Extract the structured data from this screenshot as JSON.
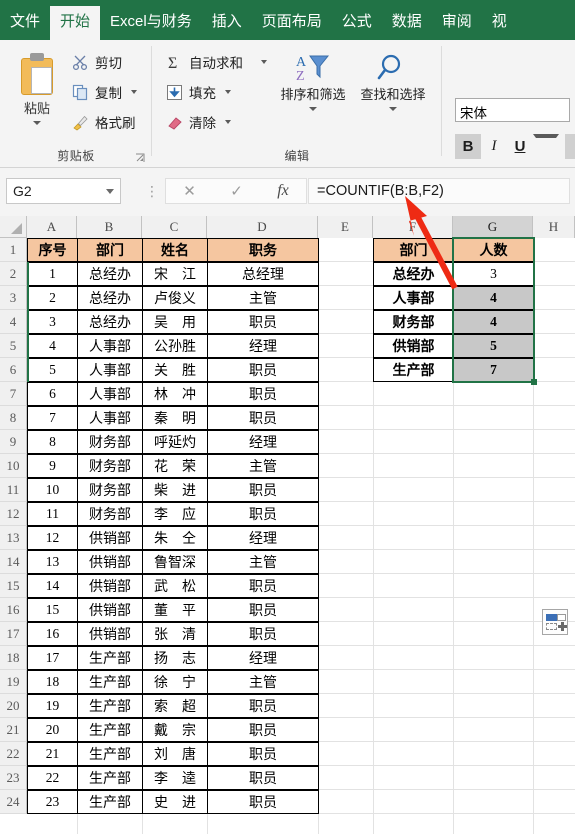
{
  "ribbon": {
    "tabs": [
      {
        "label": "文件",
        "active": false
      },
      {
        "label": "开始",
        "active": true
      },
      {
        "label": "Excel与财务",
        "active": false
      },
      {
        "label": "插入",
        "active": false
      },
      {
        "label": "页面布局",
        "active": false
      },
      {
        "label": "公式",
        "active": false
      },
      {
        "label": "数据",
        "active": false
      },
      {
        "label": "审阅",
        "active": false
      },
      {
        "label": "视",
        "active": false
      }
    ],
    "groups": [
      {
        "name": "clipboard",
        "label": "剪贴板"
      },
      {
        "name": "editing",
        "label": "编辑"
      }
    ],
    "clipboard": {
      "paste_label": "粘贴",
      "paste_icon": "clipboard-icon",
      "cut_label": "剪切",
      "cut_icon": "scissors-icon",
      "copy_label": "复制",
      "copy_icon": "copy-icon",
      "format_painter_label": "格式刷",
      "format_painter_icon": "paintbrush-icon",
      "dialog_launcher_icon": "dialog-launcher-icon"
    },
    "editing": {
      "autosum_label": "自动求和",
      "autosum_icon": "sigma-icon",
      "fill_label": "填充",
      "fill_icon": "fill-down-icon",
      "clear_label": "清除",
      "clear_icon": "eraser-icon",
      "sort_filter_label": "排序和筛选",
      "sort_filter_icon": "sort-filter-icon",
      "find_select_label": "查找和选择",
      "find_select_icon": "magnifier-icon"
    },
    "font": {
      "name_value": "宋体",
      "bold_label": "B",
      "bold_active": true,
      "italic_label": "I",
      "underline_label": "U",
      "borders_icon": "borders-icon"
    }
  },
  "formula_bar": {
    "name_box_value": "G2",
    "cancel_icon": "cancel-x-icon",
    "confirm_icon": "confirm-check-icon",
    "fx_label": "fx",
    "formula_value": "=COUNTIF(B:B,F2)",
    "handle_icon": "grip-dots-icon"
  },
  "sheet": {
    "columns": [
      "A",
      "B",
      "C",
      "D",
      "E",
      "F",
      "G",
      "H"
    ],
    "selected_column": "G",
    "rows": [
      "1",
      "2",
      "3",
      "4",
      "5",
      "6",
      "7",
      "8",
      "9",
      "10",
      "11",
      "12",
      "13",
      "14",
      "15",
      "16",
      "17",
      "18",
      "19",
      "20",
      "21",
      "22",
      "23",
      "24"
    ],
    "left_table": {
      "headers": [
        "序号",
        "部门",
        "姓名",
        "职务"
      ],
      "rows": [
        [
          "1",
          "总经办",
          "宋　江",
          "总经理"
        ],
        [
          "2",
          "总经办",
          "卢俊义",
          "主管"
        ],
        [
          "3",
          "总经办",
          "吴　用",
          "职员"
        ],
        [
          "4",
          "人事部",
          "公孙胜",
          "经理"
        ],
        [
          "5",
          "人事部",
          "关　胜",
          "职员"
        ],
        [
          "6",
          "人事部",
          "林　冲",
          "职员"
        ],
        [
          "7",
          "人事部",
          "秦　明",
          "职员"
        ],
        [
          "8",
          "财务部",
          "呼延灼",
          "经理"
        ],
        [
          "9",
          "财务部",
          "花　荣",
          "主管"
        ],
        [
          "10",
          "财务部",
          "柴　进",
          "职员"
        ],
        [
          "11",
          "财务部",
          "李　应",
          "职员"
        ],
        [
          "12",
          "供销部",
          "朱　仝",
          "经理"
        ],
        [
          "13",
          "供销部",
          "鲁智深",
          "主管"
        ],
        [
          "14",
          "供销部",
          "武　松",
          "职员"
        ],
        [
          "15",
          "供销部",
          "董　平",
          "职员"
        ],
        [
          "16",
          "供销部",
          "张　清",
          "职员"
        ],
        [
          "17",
          "生产部",
          "扬　志",
          "经理"
        ],
        [
          "18",
          "生产部",
          "徐　宁",
          "主管"
        ],
        [
          "19",
          "生产部",
          "索　超",
          "职员"
        ],
        [
          "20",
          "生产部",
          "戴　宗",
          "职员"
        ],
        [
          "21",
          "生产部",
          "刘　唐",
          "职员"
        ],
        [
          "22",
          "生产部",
          "李　逵",
          "职员"
        ],
        [
          "23",
          "生产部",
          "史　进",
          "职员"
        ]
      ]
    },
    "summary_table": {
      "headers": [
        "部门",
        "人数"
      ],
      "rows": [
        [
          "总经办",
          "3"
        ],
        [
          "人事部",
          "4"
        ],
        [
          "财务部",
          "4"
        ],
        [
          "供销部",
          "5"
        ],
        [
          "生产部",
          "7"
        ]
      ]
    },
    "quick_analysis_icon": "paste-options-icon",
    "annotation_arrow_icon": "red-arrow-annotation"
  },
  "colors": {
    "ribbon_green": "#217346",
    "header_fill": "#f5c6a0",
    "selection_green": "#217346",
    "selected_fill": "#c8c8c8",
    "annotation_red": "#ee2b14"
  }
}
